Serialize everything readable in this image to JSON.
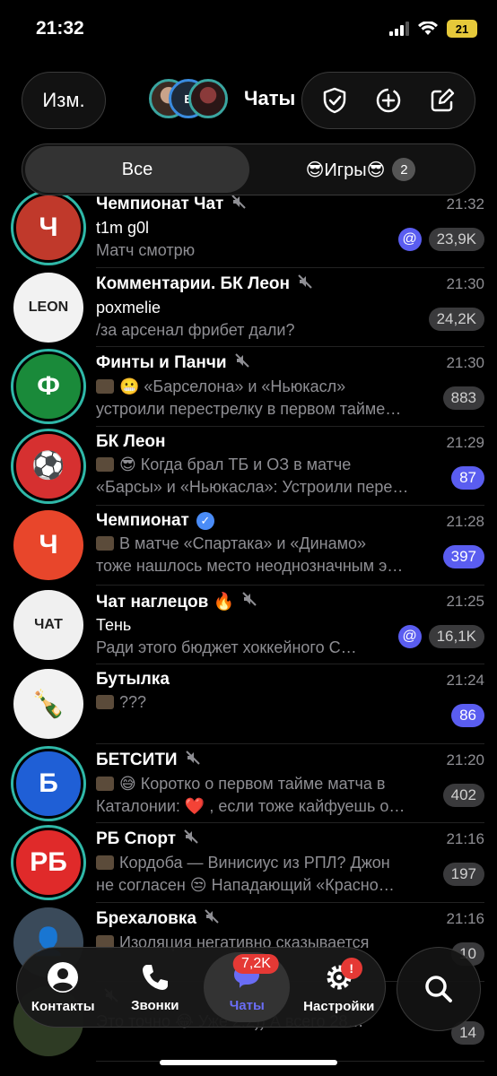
{
  "status_bar": {
    "time": "21:32",
    "battery": "21"
  },
  "header": {
    "edit_label": "Изм.",
    "title": "Чаты",
    "story_label": "Б"
  },
  "filters": {
    "all_label": "Все",
    "games_label": "😎Игры😎",
    "games_count": "2"
  },
  "chats": [
    {
      "name": "Чемпионат Чат",
      "time": "21:32",
      "sender": "t1m g0l",
      "message": "Матч смотрю",
      "badge": "23,9K",
      "badge_style": "muted",
      "mention": "@",
      "muted": true,
      "avatar_text": "Ч",
      "avatar_bg": "#c0392b"
    },
    {
      "name": "Комментарии. БК Леон",
      "time": "21:30",
      "sender": "poxmelie",
      "message": "/за арсенал фрибет дали?",
      "badge": "24,2K",
      "badge_style": "muted",
      "mention": "",
      "muted": true,
      "avatar_text": "LEON",
      "avatar_bg": "#f2f2f2"
    },
    {
      "name": "Финты и Панчи",
      "time": "21:30",
      "sender": "",
      "line1": "😬 «Барселона» и «Ньюкасл»",
      "message": "устроили перестрелку в первом тайме…",
      "badge": "883",
      "badge_style": "muted",
      "mention": "",
      "muted": true,
      "avatar_text": "Ф",
      "avatar_bg": "#1a8a3a"
    },
    {
      "name": "БК Леон",
      "time": "21:29",
      "sender": "",
      "line1": "😎 Когда брал ТБ и ОЗ в матче",
      "message": "«Барсы» и «Ньюкасла»: Устроили пере…",
      "badge": "87",
      "badge_style": "active",
      "mention": "",
      "muted": false,
      "avatar_text": "⚽",
      "avatar_bg": "#d63030"
    },
    {
      "name": "Чемпионат",
      "time": "21:28",
      "sender": "",
      "line1": "В матче «Спартака» и «Динамо»",
      "message": "тоже нашлось место неоднозначным э…",
      "badge": "397",
      "badge_style": "active",
      "mention": "",
      "muted": false,
      "verified": true,
      "avatar_text": "Ч",
      "avatar_bg": "#e8462b"
    },
    {
      "name": "Чат наглецов 🔥",
      "time": "21:25",
      "sender": "Тень",
      "message": "Ради этого бюджет хоккейного С…",
      "badge": "16,1K",
      "badge_style": "muted",
      "mention": "@",
      "muted": true,
      "avatar_text": "ЧАТ",
      "avatar_bg": "#f0f0f0"
    },
    {
      "name": "Бутылка",
      "time": "21:24",
      "sender": "",
      "line1": "???",
      "message": "",
      "badge": "86",
      "badge_style": "active",
      "mention": "",
      "muted": false,
      "avatar_text": "🍾",
      "avatar_bg": "#f2f2f2"
    },
    {
      "name": "БЕТСИТИ",
      "time": "21:20",
      "sender": "",
      "line1": "😅 Коротко о первом тайме матча в",
      "message": "Каталонии: ❤️ , если тоже кайфуешь о…",
      "badge": "402",
      "badge_style": "muted",
      "mention": "",
      "muted": true,
      "avatar_text": "Б",
      "avatar_bg": "#1f5fd6"
    },
    {
      "name": "РБ Спорт",
      "time": "21:16",
      "sender": "",
      "line1": "Кордоба — Винисиус из РПЛ? Джон",
      "message": "не согласен 😒 Нападающий «Красно…",
      "badge": "197",
      "badge_style": "muted",
      "mention": "",
      "muted": true,
      "avatar_text": "РБ",
      "avatar_bg": "#e02a2a"
    },
    {
      "name": "Брехаловка",
      "time": "21:16",
      "sender": "",
      "line1": "Изоляция негативно сказывается",
      "message": "",
      "badge": "10",
      "badge_style": "muted",
      "mention": "",
      "muted": true,
      "avatar_text": "👤",
      "avatar_bg": "#3a4a5a"
    },
    {
      "name": "",
      "time": "",
      "sender": "",
      "line1": "",
      "message": "Это точно 😂 Уже 2:2)) А всего 28…",
      "badge": "14",
      "badge_style": "muted",
      "mention": "",
      "muted": true,
      "avatar_text": "",
      "avatar_bg": "#2e3b24"
    }
  ],
  "tab_bar": {
    "contacts": "Контакты",
    "calls": "Звонки",
    "chats": "Чаты",
    "chats_badge": "7,2K",
    "settings": "Настройки",
    "settings_badge": "!"
  }
}
